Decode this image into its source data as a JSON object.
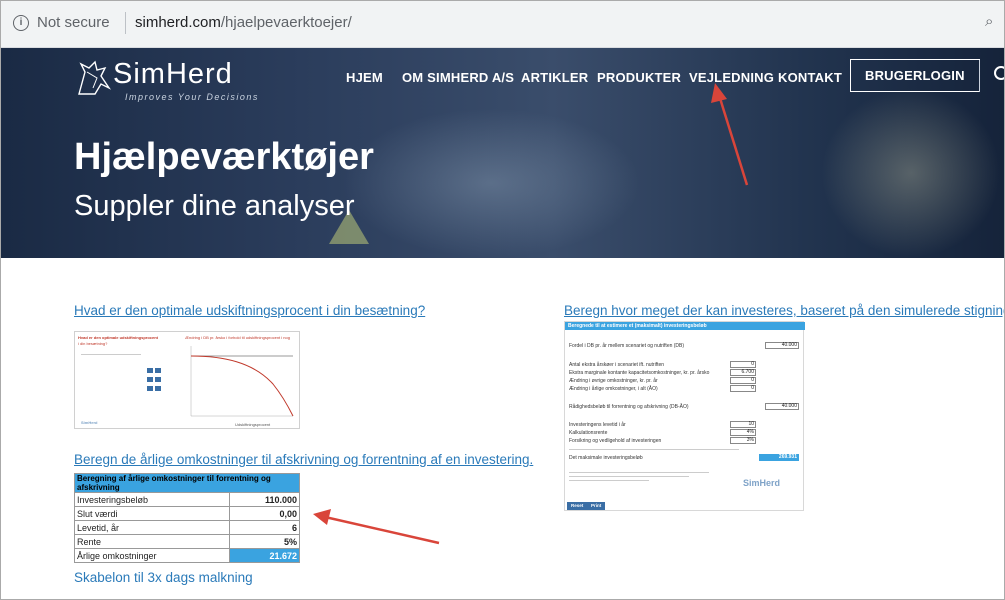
{
  "browser": {
    "security": "Not secure",
    "url_domain": "simherd.com",
    "url_path": "/hjaelpevaerktoejer/",
    "info_icon": "info-icon",
    "zoom_icon": "zoom-icon"
  },
  "site": {
    "logo_name": "SimHerd",
    "logo_tagline": "Improves Your Decisions",
    "nav": [
      "HJEM",
      "OM SIMHERD A/S",
      "ARTIKLER",
      "PRODUKTER",
      "VEJLEDNING",
      "KONTAKT"
    ],
    "login": "BRUGERLOGIN",
    "search_icon": "search-icon"
  },
  "hero": {
    "title": "Hjælpeværktøjer",
    "subtitle": "Suppler dine analyser"
  },
  "tools": {
    "replacement_link": "Hvad er den optimale udskiftningsprocent i din besætning?",
    "invest_link": "Beregn hvor meget der kan investeres, baseret på den simulerede stigning i DB",
    "cost_link": "Beregn de årlige omkostninger til afskrivning og forrentning af en investering.",
    "milking_link": "Skabelon til 3x dags malkning"
  },
  "cost_table": {
    "header": "Beregning af årlige omkostninger til forrentning og afskrivning",
    "rows": [
      {
        "label": "Investeringsbeløb",
        "value": "110.000"
      },
      {
        "label": "Slut værdi",
        "value": "0,00"
      },
      {
        "label": "Levetid, år",
        "value": "6"
      },
      {
        "label": "Rente",
        "value": "5%"
      }
    ],
    "result_label": "Årlige omkostninger",
    "result_value": "21.672",
    "accent": "#3aa3e0"
  },
  "invest_form": {
    "header": "Beregnede til at estimere et (maksimalt) investeringsbeløb",
    "fordel_label": "Fordel i DB pr. år mellem scenariet og nutriften (DB)",
    "fordel_value": "40.000",
    "lines": [
      {
        "label": "Antal ekstra årskøer i scenariet ift. nutriften",
        "value": "0"
      },
      {
        "label": "Ekstra marginale kontante kapacitetsomkostninger, kr. pr. årsko",
        "value": "6.700"
      },
      {
        "label": "Ændring i øvrige omkostninger, kr. pr. år",
        "value": "0"
      },
      {
        "label": "Ændring i årlige omkostninger, i alt (ÅO)",
        "value": "0"
      }
    ],
    "margin_label": "Rådighedsbeløb til forrentning og afskrivning (DB-ÅO)",
    "margin_value": "40.000",
    "params": [
      {
        "label": "Investeringens levetid i år",
        "value": "10"
      },
      {
        "label": "Kalkulationsrente",
        "value": "4%"
      },
      {
        "label": "Forsikring og vedligehold af investeringen",
        "value": "3%"
      }
    ],
    "max_label": "Det maksimale investeringsbeløb",
    "max_value": "269.931",
    "btn_reset": "Reset",
    "btn_print": "Print",
    "logo": "SimHerd"
  },
  "replacement_chart": {
    "title": "Ændring i DB pr. årsko i forhold til udskiftningsprocent i nog",
    "x_label": "Udskiftningsprocent",
    "left_title": "Hvad er den optimale udskiftningsprocent",
    "left_sub": "i din besætning?",
    "logo": "SimHerd"
  },
  "colors": {
    "link": "#2a7ab9",
    "arrow": "#d9453a"
  }
}
